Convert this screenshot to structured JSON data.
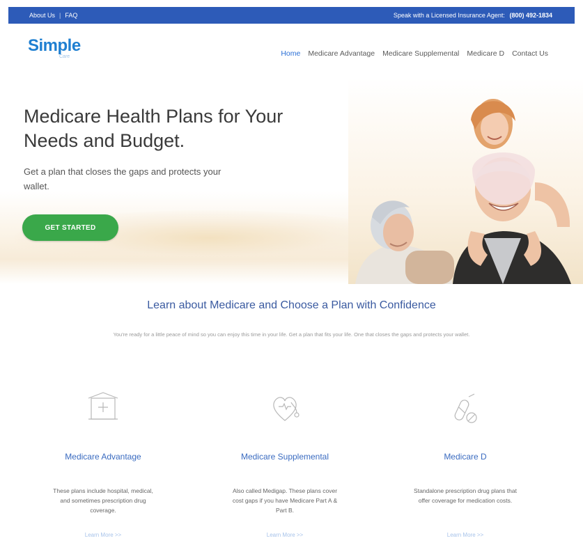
{
  "topbar": {
    "links": [
      "About Us",
      "FAQ"
    ],
    "separator": "|",
    "agent_text": "Speak with a Licensed Insurance Agent:",
    "phone": "(800) 492-1834"
  },
  "brand": {
    "name": "Simple",
    "tagline": "Care"
  },
  "nav": {
    "items": [
      "Home",
      "Medicare Advantage",
      "Medicare Supplemental",
      "Medicare D",
      "Contact Us"
    ],
    "active": "Home",
    "active_color": "#2a6fd6"
  },
  "hero": {
    "title": "Medicare Health Plans for Your Needs and Budget.",
    "subtitle": "Get a plan that closes the gaps and protects your wallet.",
    "cta_label": "GET STARTED",
    "cta_color": "#3aa84a"
  },
  "intro": {
    "heading": "Learn about Medicare and Choose a Plan with Confidence",
    "text": "You're ready for a little peace of mind so you can enjoy this time in your life. Get a plan that fits your life. One that closes the gaps and protects your wallet."
  },
  "plans": [
    {
      "icon": "hospital-icon",
      "title": "Medicare Advantage",
      "description": "These plans include hospital, medical, and sometimes prescription drug coverage.",
      "link": "Learn More >>"
    },
    {
      "icon": "heart-stethoscope-icon",
      "title": "Medicare Supplemental",
      "description": "Also called Medigap. These plans cover cost gaps if you have Medicare Part A & Part B.",
      "link": "Learn More >>"
    },
    {
      "icon": "pill-capsule-icon",
      "title": "Medicare D",
      "description": "Standalone prescription drug plans that offer coverage for medication costs.",
      "link": "Learn More >>"
    }
  ],
  "colors": {
    "topbar": "#2d5bb8",
    "brand": "#1f7fd1",
    "heading": "#3a5aa0"
  }
}
